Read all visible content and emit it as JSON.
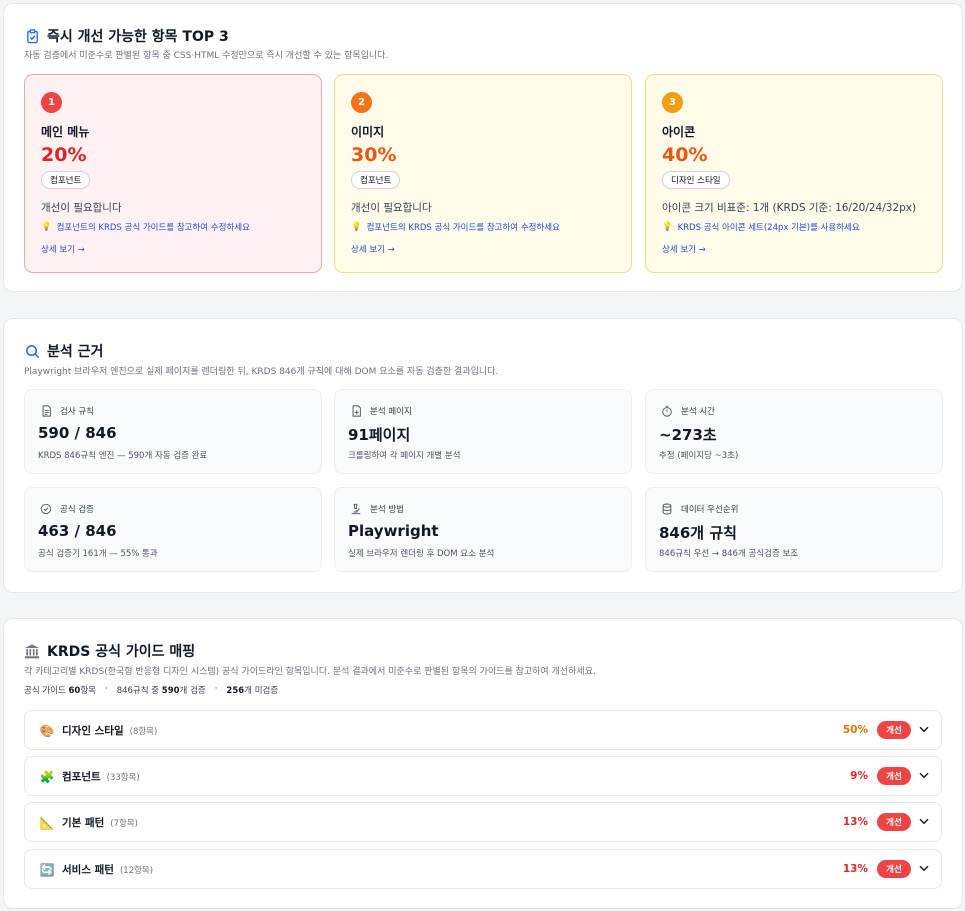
{
  "top3": {
    "title": "즉시 개선 가능한 항목 TOP 3",
    "subtitle": "자동 검증에서 미준수로 판별된 항목 중 CSS·HTML 수정만으로 즉시 개선할 수 있는 항목입니다.",
    "cards": [
      {
        "rank": "1",
        "name": "메인 메뉴",
        "percent": "20%",
        "category": "컴포넌트",
        "message": "개선이 필요합니다",
        "tip": "컴포넌트의 KRDS 공식 가이드를 참고하여 수정하세요",
        "link": "상세 보기 →",
        "rank_color": "#ef4444",
        "pct_color": "#dc2626"
      },
      {
        "rank": "2",
        "name": "이미지",
        "percent": "30%",
        "category": "컴포넌트",
        "message": "개선이 필요합니다",
        "tip": "컴포넌트의 KRDS 공식 가이드를 참고하여 수정하세요",
        "link": "상세 보기 →",
        "rank_color": "#f97316",
        "pct_color": "#ea580c"
      },
      {
        "rank": "3",
        "name": "아이콘",
        "percent": "40%",
        "category": "디자인 스타일",
        "message": "아이콘 크기 비표준: 1개 (KRDS 기준: 16/20/24/32px)",
        "tip": "KRDS 공식 아이콘 세트(24px 기본)를 사용하세요",
        "link": "상세 보기 →",
        "rank_color": "#f59e0b",
        "pct_color": "#ea580c"
      }
    ]
  },
  "analysis": {
    "title": "분석 근거",
    "subtitle": "Playwright 브라우저 엔진으로 실제 페이지를 렌더링한 뒤, KRDS 846개 규칙에 대해 DOM 요소를 자동 검증한 결과입니다.",
    "cards": [
      {
        "icon": "document-icon",
        "label": "검사 규칙",
        "value": "590 / 846",
        "desc": "KRDS 846규칙 엔진 — 590개 자동 검증 완료"
      },
      {
        "icon": "add-page-icon",
        "label": "분석 페이지",
        "value": "91페이지",
        "desc": "크롤링하여 각 페이지 개별 분석"
      },
      {
        "icon": "stopwatch-icon",
        "label": "분석 시간",
        "value": "~273초",
        "desc": "추정 (페이지당 ~3초)"
      },
      {
        "icon": "check-circle-icon",
        "label": "공식 검증",
        "value": "463 / 846",
        "desc": "공식 검증기 161개 — 55% 통과"
      },
      {
        "icon": "microscope-icon",
        "label": "분석 방법",
        "value": "Playwright",
        "desc": "실제 브라우저 렌더링 후 DOM 요소 분석"
      },
      {
        "icon": "database-icon",
        "label": "데이터 우선순위",
        "value": "846개 규칙",
        "desc": "846규칙 우선 → 846개 공식검증 보조"
      }
    ]
  },
  "krds": {
    "title": "KRDS 공식 가이드 매핑",
    "subtitle": "각 카테고리별 KRDS(한국형 반응형 디자인 시스템) 공식 가이드라인 항목입니다. 분석 결과에서 미준수로 판별된 항목의 가이드를 참고하여 개선하세요.",
    "stats": {
      "guide_label": "공식 가이드",
      "guide_count": "60",
      "guide_unit": "항목",
      "rules_label": "846규칙 중",
      "rules_count": "590",
      "rules_unit": "개 검증",
      "unverified_count": "256",
      "unverified_unit": "개 미검증"
    },
    "rows": [
      {
        "emoji": "🎨",
        "icon": "palette-icon",
        "name": "디자인 스타일",
        "count": "(8항목)",
        "percent": "50%",
        "pct_color": "#d97706",
        "badge": "개선"
      },
      {
        "emoji": "🧩",
        "icon": "puzzle-icon",
        "name": "컴포넌트",
        "count": "(33항목)",
        "percent": "9%",
        "pct_color": "#dc2626",
        "badge": "개선"
      },
      {
        "emoji": "📐",
        "icon": "ruler-icon",
        "name": "기본 패턴",
        "count": "(7항목)",
        "percent": "13%",
        "pct_color": "#dc2626",
        "badge": "개선"
      },
      {
        "emoji": "🔄",
        "icon": "refresh-icon",
        "name": "서비스 패턴",
        "count": "(12항목)",
        "percent": "13%",
        "pct_color": "#dc2626",
        "badge": "개선"
      }
    ]
  }
}
